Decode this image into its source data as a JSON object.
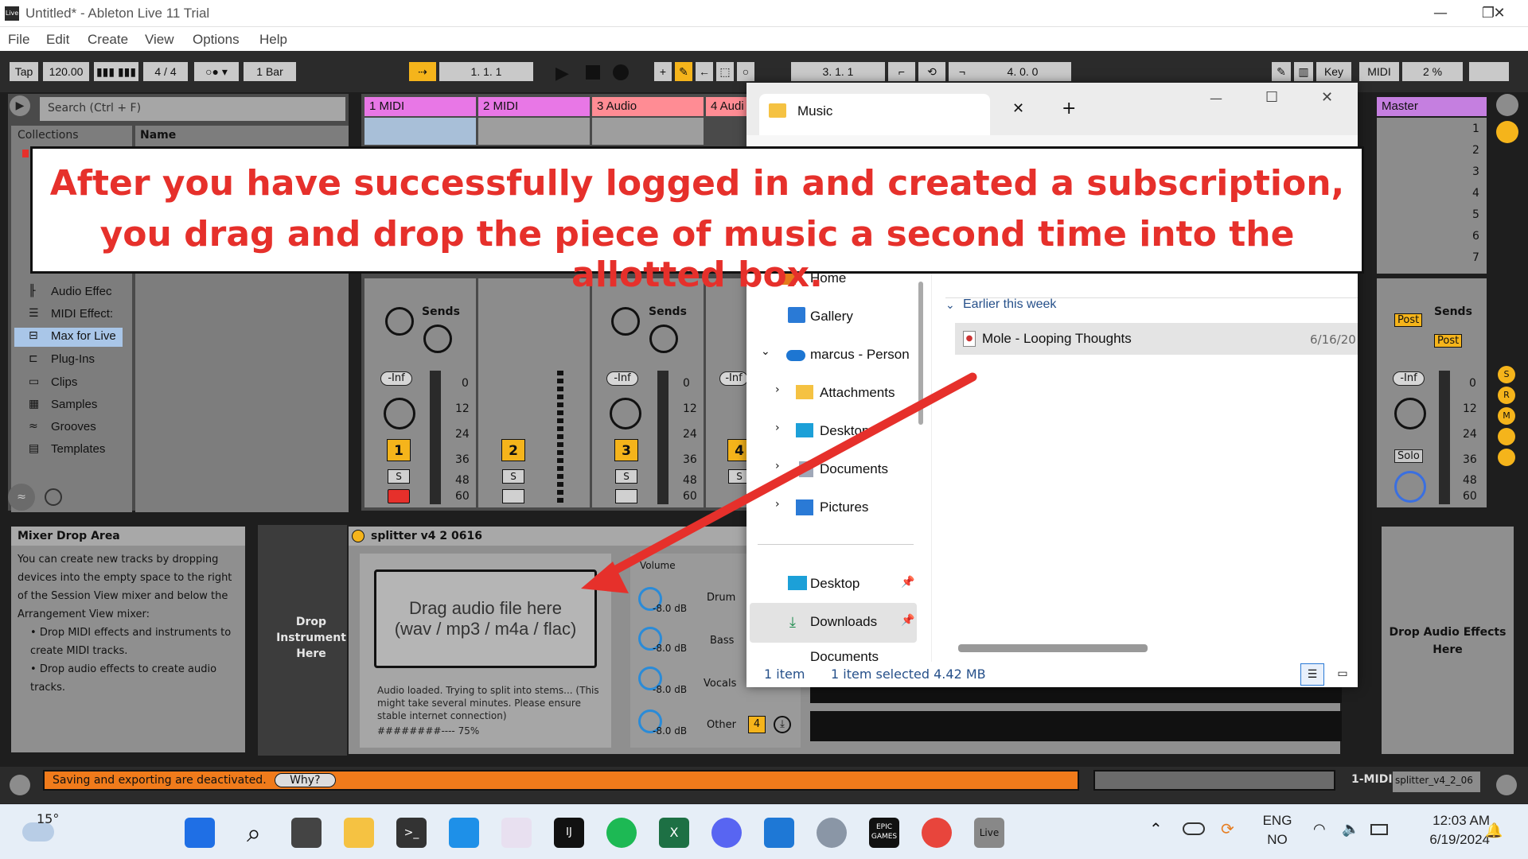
{
  "window": {
    "title": "Untitled* - Ableton Live 11 Trial",
    "app_icon_label": "Live",
    "controls": [
      "—",
      "❐",
      "✕"
    ]
  },
  "menubar": [
    "File",
    "Edit",
    "Create",
    "View",
    "Options",
    "Help"
  ],
  "controlbar": {
    "tap": "Tap",
    "tempo": "120.00",
    "time_signature": "4 / 4",
    "quantize": "1 Bar",
    "arrangement_position": "1.   1.   1",
    "loop_start": "3.   1.   1",
    "loop_length": "4.   0.   0",
    "key": "Key",
    "midi": "MIDI",
    "cpu": "2 %"
  },
  "browser": {
    "search_placeholder": "Search (Ctrl + F)",
    "collections_label": "Collections",
    "name_header": "Name",
    "categories": [
      "Audio Effec",
      "MIDI Effect:",
      "Max for Live",
      "Plug-Ins",
      "Clips",
      "Samples",
      "Grooves",
      "Templates"
    ],
    "selected_category": "Max for Live"
  },
  "tracks": [
    {
      "name": "1 MIDI",
      "color": "#e877e6",
      "number": "1"
    },
    {
      "name": "2 MIDI",
      "color": "#e877e6",
      "number": "2"
    },
    {
      "name": "3 Audio",
      "color": "#ff8c94",
      "number": "3"
    },
    {
      "name": "4 Audi",
      "color": "#ff8c94",
      "number": "4"
    }
  ],
  "master": {
    "name": "Master",
    "scenes": [
      "1",
      "2",
      "3",
      "4",
      "5",
      "6",
      "7"
    ],
    "post_label": "Post",
    "solo_label": "Solo",
    "sends_label": "Sends"
  },
  "mixer": {
    "sends_label": "Sends",
    "inf_label": "-Inf",
    "scale": [
      "0",
      "12",
      "24",
      "36",
      "48",
      "60"
    ],
    "solo_btn": "S"
  },
  "mixer_drop_area": {
    "title": "Mixer Drop Area",
    "body": "You can create new tracks by dropping devices into the empty space to the right of the Session View mixer and below the Arrangement View mixer:",
    "bullets": [
      "Drop MIDI effects and instruments to create MIDI tracks.",
      "Drop audio effects to create audio tracks."
    ]
  },
  "drop_instrument": "Drop Instrument Here",
  "drop_audio_effects": "Drop Audio Effects Here",
  "device": {
    "title": "splitter  v4  2  0616",
    "drag_box_line1": "Drag audio file here",
    "drag_box_line2": "(wav / mp3 / m4a / flac)",
    "status": "Audio loaded. Trying to split into stems... (This might take several minutes. Please ensure stable internet connection)",
    "progress_text": "########---- 75%",
    "volume_label": "Volume",
    "stems": [
      {
        "name": "Drum",
        "db": "-8.0 dB"
      },
      {
        "name": "Bass",
        "db": "-8.0 dB"
      },
      {
        "name": "Vocals",
        "db": "-8.0 dB"
      },
      {
        "name": "Other",
        "db": "-8.0 dB"
      }
    ],
    "other_number": "4"
  },
  "status_bar": {
    "message": "Saving and exporting are deactivated.",
    "why": "Why?",
    "track_label": "1-MIDI",
    "device_label": "splitter_v4_2_06"
  },
  "explorer": {
    "tab_title": "Music",
    "nav": {
      "home": "Home",
      "gallery": "Gallery",
      "onedrive": "marcus - Person",
      "attachments": "Attachments",
      "desktop": "Desktop",
      "documents": "Documents",
      "pictures": "Pictures",
      "pinned_desktop": "Desktop",
      "pinned_downloads": "Downloads",
      "pinned_documents": "Documents"
    },
    "group_header": "Earlier this week",
    "file_name": "Mole - Looping Thoughts",
    "file_date": "6/16/20",
    "status_count": "1 item",
    "status_selected": "1 item selected  4.42 MB"
  },
  "annotation": {
    "line1": "After you have  successfully logged in and created a subscription,",
    "line2": "you drag and drop the piece of music a second time into the allotted box.",
    "color": "#e6302b"
  },
  "taskbar": {
    "weather": "15°",
    "language_line1": "ENG",
    "language_line2": "NO",
    "time": "12:03 AM",
    "date": "6/19/2024",
    "apps": [
      "start",
      "search",
      "task-view",
      "file-explorer",
      "terminal",
      "vscode",
      "slack",
      "intellij",
      "spotify",
      "excel",
      "discord",
      "mail",
      "settings",
      "epic-games",
      "chrome",
      "live"
    ],
    "epic_label": "EPIC GAMES",
    "live_label": "Live"
  }
}
